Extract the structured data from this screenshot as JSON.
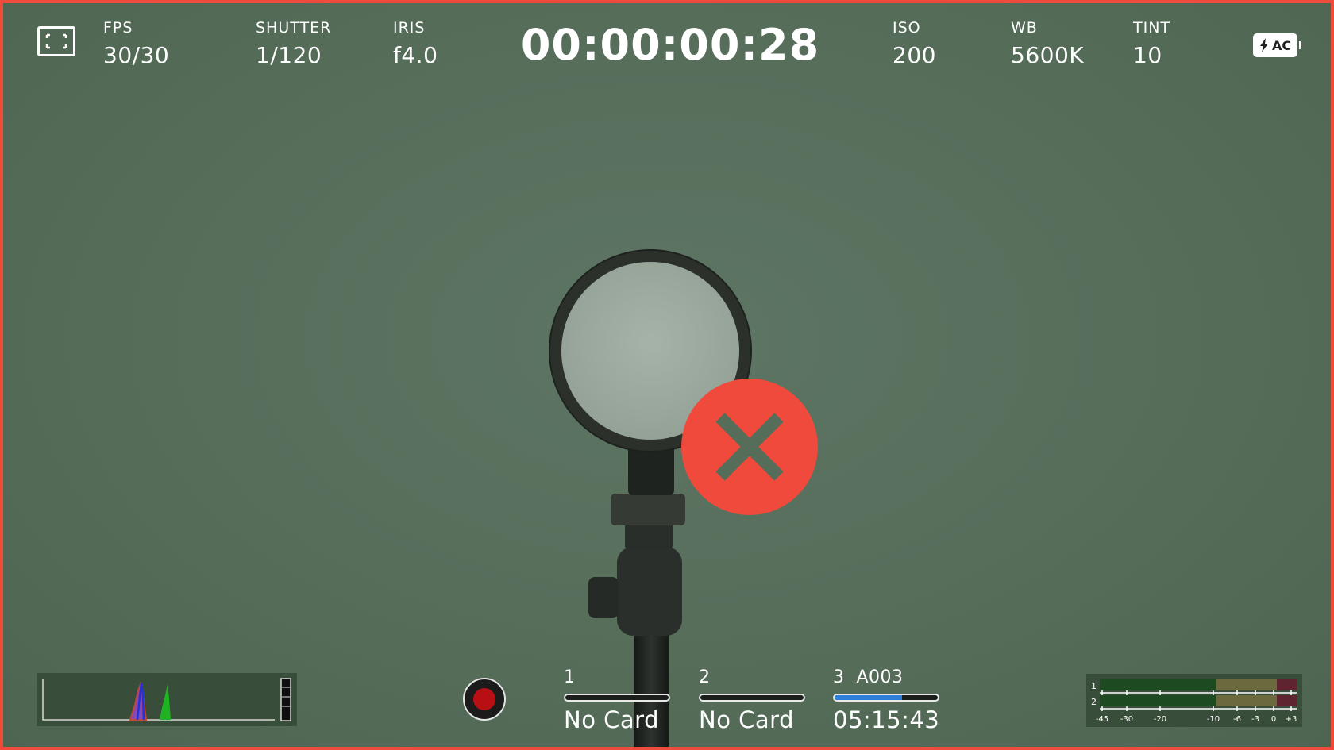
{
  "header": {
    "fps": {
      "label": "FPS",
      "value": "30/30"
    },
    "shutter": {
      "label": "SHUTTER",
      "value": "1/120"
    },
    "iris": {
      "label": "IRIS",
      "value": "f4.0"
    },
    "timecode": "00:00:00:28",
    "iso": {
      "label": "ISO",
      "value": "200"
    },
    "wb": {
      "label": "WB",
      "value": "5600K"
    },
    "tint": {
      "label": "TINT",
      "value": "10"
    },
    "power": {
      "label": "AC",
      "icon": "lightning-icon"
    }
  },
  "overlay": {
    "icon": "close-icon",
    "color": "#f04a3c"
  },
  "record": {
    "icon": "record-icon",
    "color": "#b80f14"
  },
  "slots": [
    {
      "number": "1",
      "status": "No Card",
      "fill": 0
    },
    {
      "number": "2",
      "status": "No Card",
      "fill": 0
    },
    {
      "number": "3  A003",
      "status": "05:15:43",
      "fill": 0.65
    }
  ],
  "audio": {
    "channels": [
      "1",
      "2"
    ],
    "scale": [
      "-45",
      "-30",
      "-20",
      "-10",
      "-6",
      "-3",
      "0",
      "+3"
    ]
  },
  "colors": {
    "border": "#ef4a3a",
    "background": "#566d5a",
    "slot_fill": "#2e7fd9"
  }
}
